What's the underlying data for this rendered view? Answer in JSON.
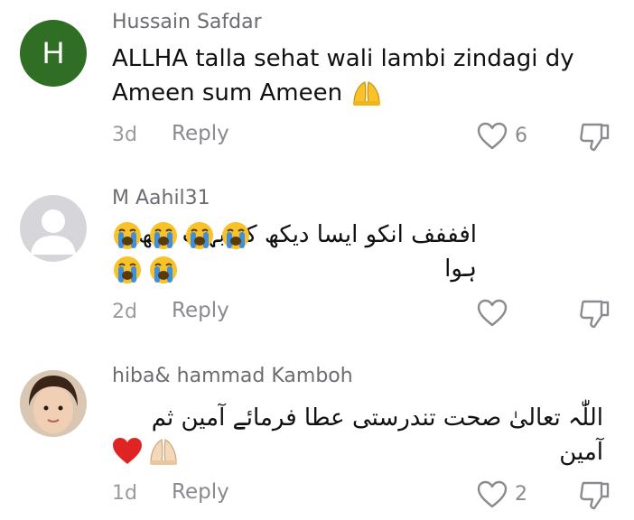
{
  "comments": [
    {
      "avatar_letter": "H",
      "avatar_color": "#2f6e24",
      "username": "Hussain Safdar",
      "text_line1": "ALLHA talla sehat wali lambi zindagi dy",
      "text_line2": "Ameen sum Ameen",
      "emoji": "folded-hands-emoji",
      "time": "3d",
      "reply_label": "Reply",
      "like_count": "6"
    },
    {
      "username": "M Aahil31",
      "text": "افففف انکو ایسا دیکھ کر بہت دکھ ہوا",
      "emoji": "crying-face-emoji",
      "time": "2d",
      "reply_label": "Reply"
    },
    {
      "username": "hiba& hammad Kamboh",
      "text": "اللّٰہ تعالیٰ صحت تندرستی عطا فرمائے آمین ثم آمین",
      "emoji": [
        "red-heart-emoji",
        "folded-hands-emoji"
      ],
      "time": "1d",
      "reply_label": "Reply",
      "like_count": "2"
    }
  ],
  "colors": {
    "username": "#6c6c72",
    "meta": "#8a8a90",
    "emoji_yellow": "#f7c22a",
    "tear_blue": "#3d8fe0",
    "heart_red": "#e02424"
  }
}
